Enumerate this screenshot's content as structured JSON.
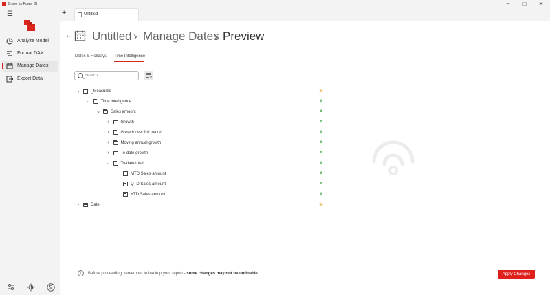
{
  "window": {
    "title": "Bravo for Power BI",
    "controls": {
      "minimize": "–",
      "maximize": "□",
      "close": "✕"
    }
  },
  "sidebar": {
    "items": [
      {
        "label": "Analyze Model",
        "icon": "analyze-icon"
      },
      {
        "label": "Format DAX",
        "icon": "format-dax-icon"
      },
      {
        "label": "Manage Dates",
        "icon": "calendar-icon",
        "active": true
      },
      {
        "label": "Export Data",
        "icon": "export-icon"
      }
    ],
    "bottom_icons": [
      "settings-sliders-icon",
      "theme-icon",
      "user-icon"
    ]
  },
  "tabs": {
    "new_tab": "+",
    "document_tab": "Untitled"
  },
  "header": {
    "crumbs": [
      "Untitled",
      "Manage Dates",
      "Preview"
    ],
    "separator": "›",
    "back": "←"
  },
  "subtabs": [
    {
      "label": "Dates & Holidays",
      "active": false
    },
    {
      "label": "Time Intelligence",
      "active": true
    }
  ],
  "search": {
    "placeholder": "Search",
    "value": ""
  },
  "tree": [
    {
      "label": "_Measures",
      "type": "table",
      "chevron": "v",
      "level": 0,
      "badge": "M"
    },
    {
      "label": "Time intelligence",
      "type": "folder",
      "chevron": "v",
      "level": 1,
      "badge": "A"
    },
    {
      "label": "Sales amount",
      "type": "folder",
      "chevron": "v",
      "level": 2,
      "badge": "A"
    },
    {
      "label": "Growth",
      "type": "folder",
      "chevron": ">",
      "level": 3,
      "badge": "A"
    },
    {
      "label": "Growth over full period",
      "type": "folder",
      "chevron": ">",
      "level": 3,
      "badge": "A"
    },
    {
      "label": "Moving annual growth",
      "type": "folder",
      "chevron": ">",
      "level": 3,
      "badge": "A"
    },
    {
      "label": "To-date growth",
      "type": "folder",
      "chevron": ">",
      "level": 3,
      "badge": "A"
    },
    {
      "label": "To-date total",
      "type": "folder",
      "chevron": "v",
      "level": 3,
      "badge": "A"
    },
    {
      "label": "MTD Sales amount",
      "type": "measure",
      "chevron": "",
      "level": 4,
      "badge": "A"
    },
    {
      "label": "QTD Sales amount",
      "type": "measure",
      "chevron": "",
      "level": 4,
      "badge": "A"
    },
    {
      "label": "YTD Sales amount",
      "type": "measure",
      "chevron": "",
      "level": 4,
      "badge": "A"
    },
    {
      "label": "Date",
      "type": "table",
      "chevron": ">",
      "level": 0,
      "badge": "M"
    }
  ],
  "badge_colors": {
    "M": "#e0a020",
    "A": "#3aa13a"
  },
  "footer": {
    "info_icon": "i",
    "notice": "Before proceeding, remember to backup your report - ",
    "notice_bold": "some changes may not be undoable.",
    "apply_button": "Apply Changes"
  },
  "colors": {
    "accent": "#e0201b"
  }
}
